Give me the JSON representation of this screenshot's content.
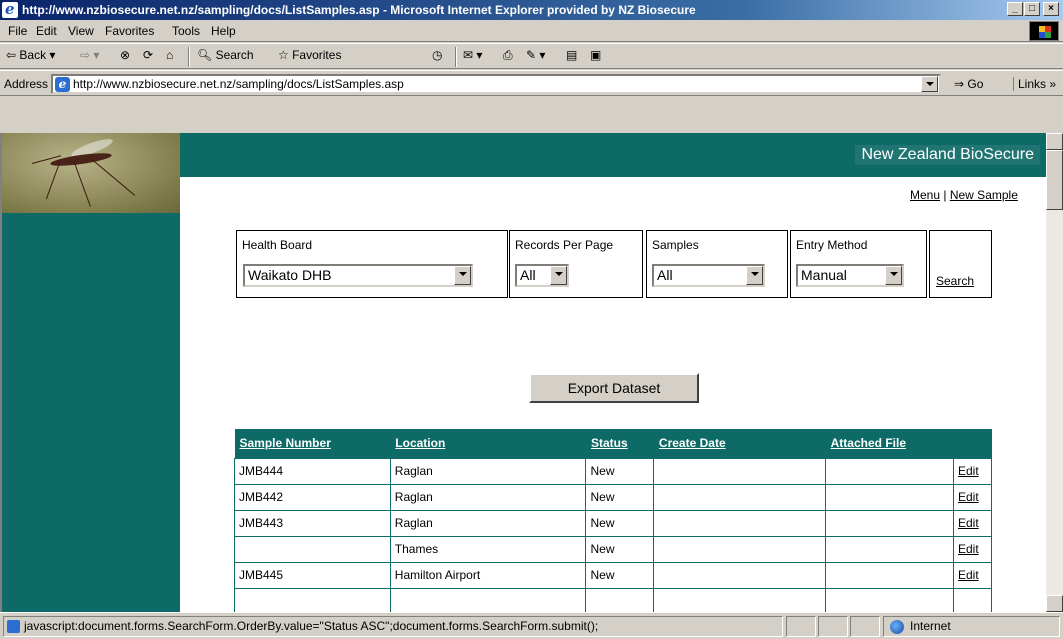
{
  "window": {
    "title": "http://www.nzbiosecure.net.nz/sampling/docs/ListSamples.asp - Microsoft Internet Explorer provided by NZ Biosecure"
  },
  "menu": [
    "File",
    "Edit",
    "View",
    "Favorites",
    "Tools",
    "Help"
  ],
  "toolbar": {
    "back": "Back",
    "search": "Search",
    "favorites": "Favorites"
  },
  "address": {
    "label": "Address",
    "url": "http://www.nzbiosecure.net.nz/sampling/docs/ListSamples.asp",
    "go": "Go",
    "links": "Links »"
  },
  "page": {
    "brand": "New Zealand BioSecure",
    "menu_link": "Menu",
    "separator": "|",
    "new_sample_link": "New Sample",
    "form": {
      "health_board": {
        "label": "Health Board",
        "value": "Waikato DHB"
      },
      "records_per_page": {
        "label": "Records Per Page",
        "value": "All"
      },
      "samples": {
        "label": "Samples",
        "value": "All"
      },
      "entry_method": {
        "label": "Entry Method",
        "value": "Manual"
      },
      "search": "Search"
    },
    "export_button": "Export Dataset",
    "table": {
      "headers": [
        "Sample Number",
        "Location",
        "Status",
        "Create Date",
        "Attached File"
      ],
      "rows": [
        {
          "sample": "JMB444",
          "location": "Raglan",
          "status": "New",
          "date": "",
          "file": "",
          "action": "Edit"
        },
        {
          "sample": "JMB442",
          "location": "Raglan",
          "status": "New",
          "date": "",
          "file": "",
          "action": "Edit"
        },
        {
          "sample": "JMB443",
          "location": "Raglan",
          "status": "New",
          "date": "",
          "file": "",
          "action": "Edit"
        },
        {
          "sample": "",
          "location": "Thames",
          "status": "New",
          "date": "",
          "file": "",
          "action": "Edit"
        },
        {
          "sample": "JMB445",
          "location": "Hamilton Airport",
          "status": "New",
          "date": "",
          "file": "",
          "action": "Edit"
        }
      ]
    }
  },
  "status": {
    "text": "javascript:document.forms.SearchForm.OrderBy.value=\"Status ASC\";document.forms.SearchForm.submit();",
    "zone": "Internet"
  },
  "colors": {
    "teal": "#0e6a66",
    "titlebar": "#0a246a"
  }
}
